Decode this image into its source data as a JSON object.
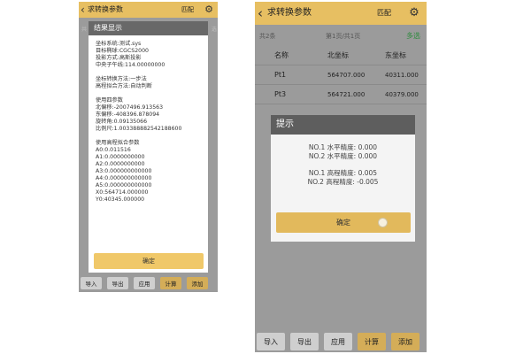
{
  "left": {
    "appbar": {
      "back_icon": "chevron-left-icon",
      "title": "求转换参数",
      "match": "匹配",
      "gear_icon": "gear-icon"
    },
    "bg_list": {
      "left_text": "共",
      "right_text": "选"
    },
    "dialog": {
      "title": "结果显示",
      "groups": [
        [
          "坐标系统:测试.sys",
          "目标椭球:CGCS2000",
          "投影方式:高斯投影",
          "中央子午线:114.00000000"
        ],
        [
          "坐标转换方法:一步法",
          "高程拟合方法:自动判断"
        ],
        [
          "使用四参数",
          "北偏移:-2007496.913563",
          "东偏移:-408396.878094",
          "旋转角:0.09135066",
          "比例尺:1.003388882542188600"
        ],
        [
          "使用高程拟合参数",
          "A0:0.011516",
          "A1:0.0000000000",
          "A2:0.0000000000",
          "A3:0.000000000000",
          "A4:0.000000000000",
          "A5:0.000000000000",
          "X0:564714.000000",
          "Y0:40345.000000"
        ]
      ],
      "ok_label": "确定"
    },
    "buttons": [
      "导入",
      "导出",
      "应用",
      "计算",
      "添加"
    ]
  },
  "right": {
    "appbar": {
      "back_icon": "chevron-left-icon",
      "title": "求转换参数",
      "match": "匹配",
      "gear_icon": "gear-icon"
    },
    "sub": {
      "count": "共2条",
      "page": "第1页/共1页",
      "multi_select": "多选"
    },
    "table": {
      "columns": [
        "名称",
        "北坐标",
        "东坐标"
      ],
      "rows": [
        [
          "Pt1",
          "564707.000",
          "40311.000"
        ],
        [
          "Pt3",
          "564721.000",
          "40379.000"
        ]
      ]
    },
    "dialog": {
      "title": "提示",
      "groups": [
        [
          "NO.1 水平精度: 0.000",
          "NO.2 水平精度: 0.000"
        ],
        [
          "NO.1 高程精度: 0.005",
          "NO.2 高程精度: -0.005"
        ]
      ],
      "ok_label": "确定"
    },
    "buttons": [
      "导入",
      "导出",
      "应用",
      "计算",
      "添加"
    ]
  },
  "colors": {
    "appbar": "#e7bf62",
    "accent_button": "#d4ad58",
    "multi_select": "#2e8b3e",
    "dialog_header": "#5e5e5e"
  }
}
